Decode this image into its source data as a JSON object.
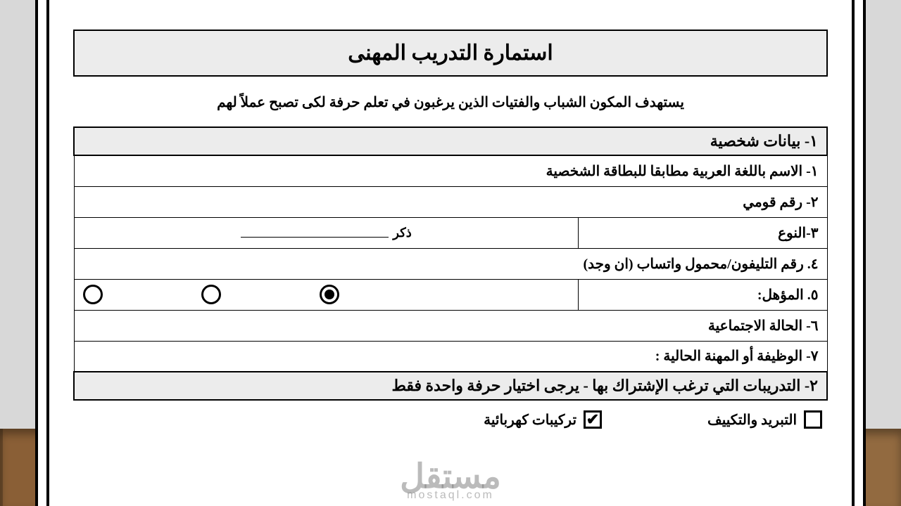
{
  "title": "استمارة التدريب المهنى",
  "intro": "يستهدف المكون الشباب والفتيات الذين يرغبون في تعلم حرفة لكى تصبح عملاً لهم",
  "section1": {
    "heading": "١- بيانات شخصية",
    "fields": {
      "name": "١- الاسم باللغة العربية مطابقا للبطاقة الشخصية",
      "national_id": "٢- رقم قومي",
      "gender_label": "٣-النوع",
      "gender_value": "ذكر",
      "phone": "٤. رقم التليفون/محمول واتساب (ان وجد)",
      "qualification": "٥. المؤهل:",
      "marital": "٦- الحالة الاجتماعية",
      "job": "٧- الوظيفة أو المهنة الحالية :"
    },
    "qualification_selected_index": 2
  },
  "section2": {
    "heading": "٢-  التدريبات التي ترغب الإشتراك بها -  يرجى اختيار حرفة واحدة فقط",
    "options": [
      {
        "label": "التبريد والتكييف",
        "checked": false
      },
      {
        "label": "تركيبات كهربائية",
        "checked": true
      }
    ]
  },
  "watermark": {
    "ar": "مستقل",
    "en": "mostaql.com"
  }
}
